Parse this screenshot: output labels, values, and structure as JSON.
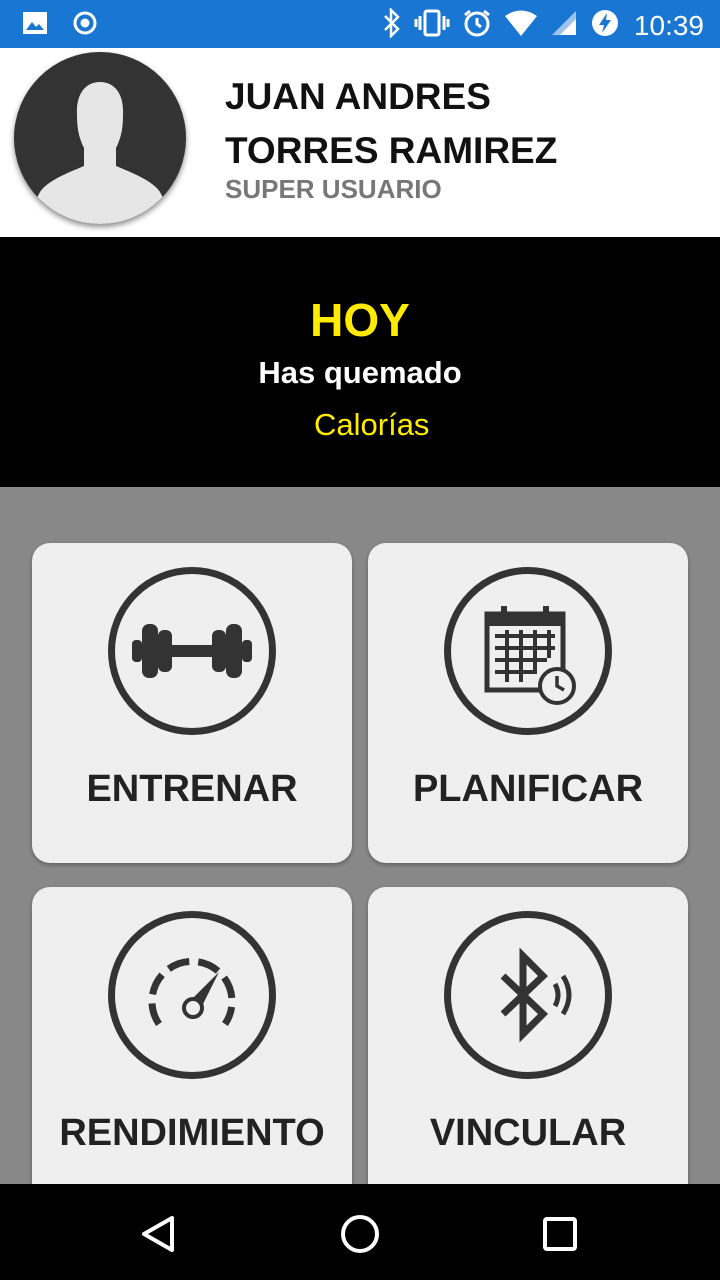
{
  "status_bar": {
    "time": "10:39",
    "icons": [
      "image-icon",
      "record-icon",
      "bluetooth-icon",
      "vibrate-icon",
      "alarm-icon",
      "wifi-icon",
      "signal-icon",
      "battery-charging-icon"
    ],
    "background_color": "#1976d2"
  },
  "profile": {
    "name_line1": "JUAN ANDRES",
    "name_line2": "TORRES RAMIREZ",
    "role": "SUPER USUARIO"
  },
  "today": {
    "title": "HOY",
    "burned_label": "Has quemado",
    "calories_label": "Calorías",
    "accent_color": "#ffeb00"
  },
  "menu": {
    "items": [
      {
        "label": "ENTRENAR",
        "icon": "dumbbell-icon"
      },
      {
        "label": "PLANIFICAR",
        "icon": "calendar-clock-icon"
      },
      {
        "label": "RENDIMIENTO",
        "icon": "speedometer-icon"
      },
      {
        "label": "VINCULAR",
        "icon": "bluetooth-connect-icon"
      }
    ]
  },
  "nav": {
    "buttons": [
      "back-icon",
      "home-icon",
      "recents-icon"
    ]
  }
}
